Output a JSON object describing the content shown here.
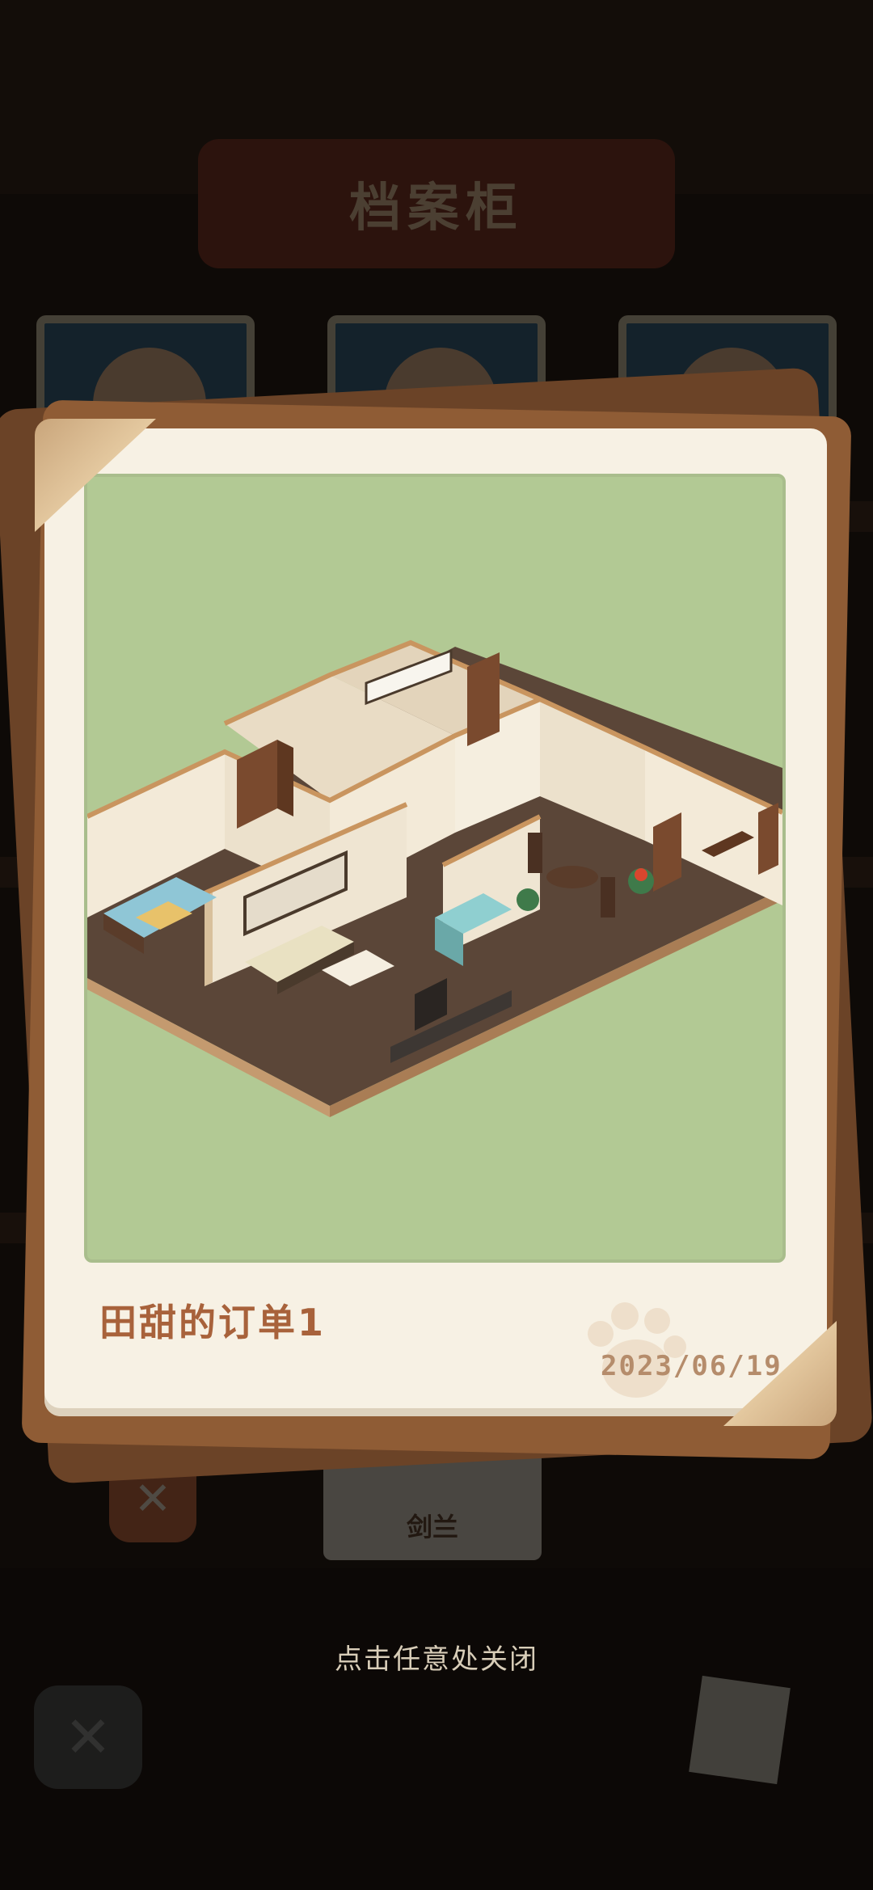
{
  "background": {
    "cabinet_title": "档案柜",
    "bottom_card_name": "剑兰"
  },
  "popup": {
    "order_title": "田甜的订单1",
    "date": "2023/06/19"
  },
  "close_hint": "点击任意处关闭",
  "colors": {
    "photo_bg": "#b2c994",
    "card_bg": "#f7f1e4",
    "title_color": "#a8623b",
    "date_color": "#b58c6b",
    "hint_color": "#d8cdb8"
  },
  "icons": [
    "paw-icon",
    "close-icon"
  ]
}
